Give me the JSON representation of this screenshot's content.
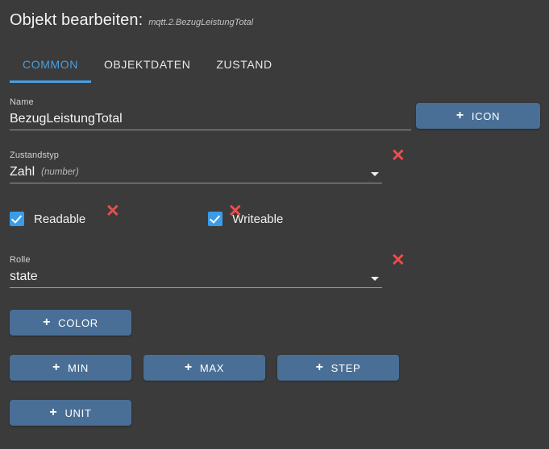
{
  "header": {
    "title": "Objekt bearbeiten:",
    "object_id": "mqtt.2.BezugLeistungTotal"
  },
  "tabs": [
    {
      "label": "COMMON",
      "active": true
    },
    {
      "label": "OBJEKTDATEN",
      "active": false
    },
    {
      "label": "ZUSTAND",
      "active": false
    }
  ],
  "fields": {
    "name": {
      "label": "Name",
      "value": "BezugLeistungTotal",
      "placeholder": "Name"
    },
    "zustandstyp": {
      "label": "Zustandstyp",
      "value": "Zahl",
      "value_hint": "(number)"
    },
    "rolle": {
      "label": "Rolle",
      "value": "state"
    }
  },
  "checkboxes": [
    {
      "label": "Readable",
      "checked": true
    },
    {
      "label": "Writeable",
      "checked": true
    }
  ],
  "clear_buttons": {
    "glyph": "✕",
    "zustandstyp_title": "Zustandstyp",
    "readable_title": "Readable",
    "writeable_title": "Writeable",
    "rolle_title": "Rolle"
  },
  "buttons": {
    "plus": "+",
    "icon": "ICON",
    "color": "COLOR",
    "min": "MIN",
    "max": "MAX",
    "step": "STEP",
    "unit": "UNIT"
  },
  "colors": {
    "background": "#3b3b3b",
    "accent_blue": "#4a9fe0",
    "button_blue": "#4a6f96",
    "checkbox_blue": "#3a9ce8",
    "clear_red": "#ef4d4d",
    "underline": "#9a9a9a"
  }
}
